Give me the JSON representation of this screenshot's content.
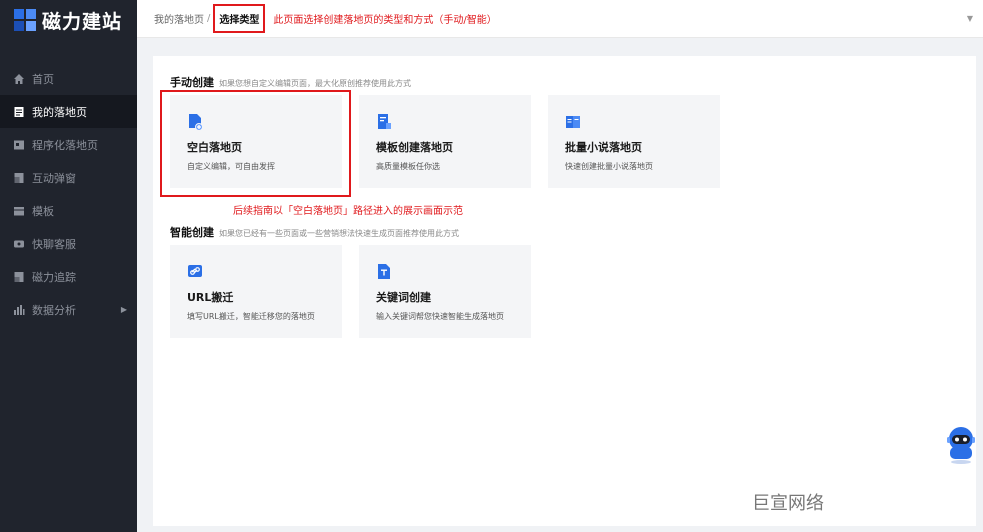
{
  "app": {
    "logo_text": "磁力建站"
  },
  "sidebar": {
    "items": [
      {
        "label": "首页",
        "icon": "home-icon"
      },
      {
        "label": "我的落地页",
        "icon": "document-icon",
        "active": true
      },
      {
        "label": "程序化落地页",
        "icon": "program-icon"
      },
      {
        "label": "互动弹窗",
        "icon": "popup-icon"
      },
      {
        "label": "模板",
        "icon": "template-icon"
      },
      {
        "label": "快聊客服",
        "icon": "chat-icon"
      },
      {
        "label": "磁力追踪",
        "icon": "tracking-icon"
      },
      {
        "label": "数据分析",
        "icon": "chart-icon",
        "has_submenu": true
      }
    ]
  },
  "breadcrumb": {
    "parent": "我的落地页",
    "separator": "/",
    "current": "选择类型"
  },
  "annotations": {
    "top_note": "此页面选择创建落地页的类型和方式（手动/智能）",
    "card_note": "后续指南以「空白落地页」路径进入的展示画面示范"
  },
  "manual": {
    "title": "手动创建",
    "desc": "如果您想自定义编辑页面，最大化原创推荐使用此方式",
    "cards": [
      {
        "title": "空白落地页",
        "desc": "自定义编辑，可自由发挥",
        "icon": "blank-page-icon"
      },
      {
        "title": "模板创建落地页",
        "desc": "高质量模板任你选",
        "icon": "template-page-icon"
      },
      {
        "title": "批量小说落地页",
        "desc": "快速创建批量小说落地页",
        "icon": "book-icon"
      }
    ]
  },
  "smart": {
    "title": "智能创建",
    "desc": "如果您已经有一些页面或一些营销想法快速生成页面推荐使用此方式",
    "cards": [
      {
        "title": "URL搬迁",
        "desc": "填写URL搬迁，智能迁移您的落地页",
        "icon": "link-icon"
      },
      {
        "title": "关键词创建",
        "desc": "输入关键词帮您快速智能生成落地页",
        "icon": "keyword-icon"
      }
    ]
  },
  "watermark": "巨宣网络",
  "colors": {
    "accent": "#2b6fe6",
    "annotation": "#e0191c",
    "sidebar": "#20242d"
  }
}
